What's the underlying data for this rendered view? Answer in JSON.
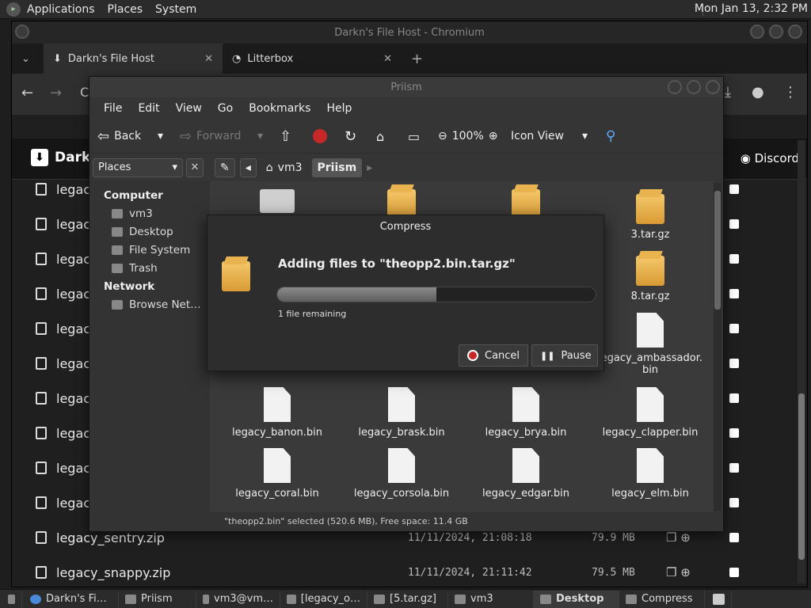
{
  "top_panel": {
    "menus": [
      "Applications",
      "Places",
      "System"
    ],
    "clock": "Mon Jan 13, 2:32 PM"
  },
  "chromium": {
    "title": "Darkn's File Host - Chromium",
    "tabs": [
      {
        "label": "Darkn's File Host",
        "active": true
      },
      {
        "label": "Litterbox",
        "active": false
      }
    ],
    "new_tab": "+",
    "address_partial": "C",
    "site_brand": "Darkn",
    "discord": "Discord",
    "files": [
      {
        "name": "legac",
        "date": "",
        "size": ""
      },
      {
        "name": "legac",
        "date": "",
        "size": ""
      },
      {
        "name": "legac",
        "date": "",
        "size": ""
      },
      {
        "name": "legac",
        "date": "",
        "size": ""
      },
      {
        "name": "legac",
        "date": "",
        "size": ""
      },
      {
        "name": "legac",
        "date": "",
        "size": ""
      },
      {
        "name": "legac",
        "date": "",
        "size": ""
      },
      {
        "name": "legac",
        "date": "",
        "size": ""
      },
      {
        "name": "legac",
        "date": "",
        "size": ""
      },
      {
        "name": "legac",
        "date": "",
        "size": ""
      },
      {
        "name": "legacy_sentry.zip",
        "date": "11/11/2024, 21:08:18",
        "size": "79.9 MB"
      },
      {
        "name": "legacy_snappy.zip",
        "date": "11/11/2024, 21:11:42",
        "size": "79.5 MB"
      }
    ]
  },
  "priism": {
    "title": "Priism",
    "menus": [
      "File",
      "Edit",
      "View",
      "Go",
      "Bookmarks",
      "Help"
    ],
    "toolbar": {
      "back": "Back",
      "forward": "Forward",
      "zoom": "100%",
      "view_mode": "Icon View"
    },
    "places_label": "Places",
    "breadcrumbs": [
      "vm3",
      "Priism"
    ],
    "sidebar": {
      "computer_header": "Computer",
      "computer_items": [
        "vm3",
        "Desktop",
        "File System",
        "Trash"
      ],
      "network_header": "Network",
      "network_items": [
        "Browse Net…"
      ]
    },
    "files": [
      {
        "name": "",
        "icon": "folder"
      },
      {
        "name": "",
        "icon": "archive"
      },
      {
        "name": "",
        "icon": "archive"
      },
      {
        "name": "3.tar.gz",
        "icon": "archive"
      },
      {
        "name": "8.tar.gz",
        "icon": "archive"
      },
      {
        "name": "legacy_ambassador.\nbin",
        "icon": "document"
      },
      {
        "name": "legacy_banon.bin",
        "icon": "document"
      },
      {
        "name": "legacy_brask.bin",
        "icon": "document"
      },
      {
        "name": "legacy_brya.bin",
        "icon": "document"
      },
      {
        "name": "legacy_clapper.bin",
        "icon": "document"
      },
      {
        "name": "legacy_coral.bin",
        "icon": "document"
      },
      {
        "name": "legacy_corsola.bin",
        "icon": "document"
      },
      {
        "name": "legacy_edgar.bin",
        "icon": "document"
      },
      {
        "name": "legacy_elm.bin",
        "icon": "document"
      }
    ],
    "status": "\"theopp2.bin\" selected (520.6 MB), Free space: 11.4 GB"
  },
  "compress_dialog": {
    "title": "Compress",
    "heading": "Adding files to \"theopp2.bin.tar.gz\"",
    "remaining": "1 file remaining",
    "progress": 0.5,
    "cancel": "Cancel",
    "pause": "Pause"
  },
  "taskbar": {
    "items": [
      {
        "label": "Darkn's Fi…",
        "active": false
      },
      {
        "label": "Priism",
        "active": false
      },
      {
        "label": "vm3@vm…",
        "active": false
      },
      {
        "label": "[legacy_o…",
        "active": false
      },
      {
        "label": "[5.tar.gz]",
        "active": false
      },
      {
        "label": "vm3",
        "active": false
      },
      {
        "label": "Desktop",
        "active": true
      },
      {
        "label": "Compress",
        "active": false
      }
    ]
  }
}
